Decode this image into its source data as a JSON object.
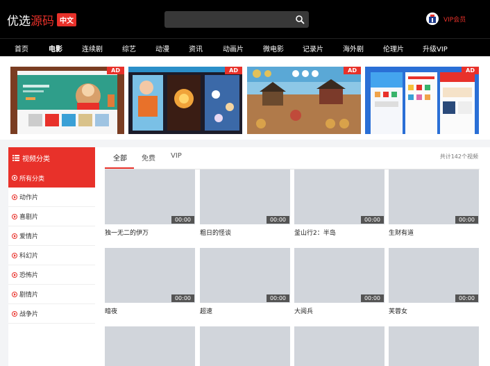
{
  "header": {
    "logo_part1": "优选",
    "logo_part2": "源码",
    "logo_tag": "中文",
    "search_placeholder": "",
    "vip_label": "VIP会员"
  },
  "nav": [
    "首页",
    "电影",
    "连续剧",
    "综艺",
    "动漫",
    "资讯",
    "动画片",
    "微电影",
    "记录片",
    "海外剧",
    "伦理片",
    "升级VIP"
  ],
  "nav_active": "电影",
  "banners": [
    {
      "ad": "AD"
    },
    {
      "ad": "AD"
    },
    {
      "ad": "AD"
    },
    {
      "ad": "AD"
    }
  ],
  "sidebar": {
    "title": "视频分类",
    "items": [
      "所有分类",
      "动作片",
      "喜剧片",
      "爱情片",
      "科幻片",
      "恐怖片",
      "剧情片",
      "战争片"
    ],
    "active": "所有分类"
  },
  "main": {
    "tabs": [
      "全部",
      "免费",
      "VIP"
    ],
    "active_tab": "全部",
    "total": "共计142个视频",
    "videos": [
      {
        "title": "独一无二的伊万",
        "duration": "00:00"
      },
      {
        "title": "粗日的怪谈",
        "duration": "00:00"
      },
      {
        "title": "釜山行2：半岛",
        "duration": "00:00"
      },
      {
        "title": "生财有道",
        "duration": "00:00"
      },
      {
        "title": "暗夜",
        "duration": "00:00"
      },
      {
        "title": "超速",
        "duration": "00:00"
      },
      {
        "title": "大阅兵",
        "duration": "00:00"
      },
      {
        "title": "芙蓉女",
        "duration": "00:00"
      },
      {
        "title": "",
        "duration": ""
      },
      {
        "title": "",
        "duration": ""
      },
      {
        "title": "",
        "duration": ""
      },
      {
        "title": "",
        "duration": ""
      }
    ]
  },
  "colors": {
    "accent": "#e8312a",
    "header_bg": "#000000",
    "thumb_placeholder": "#d1d5db"
  }
}
